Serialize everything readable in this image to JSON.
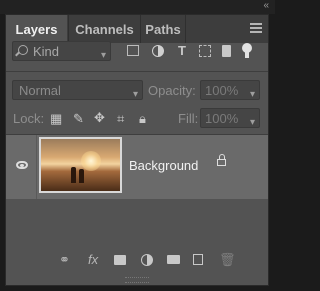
{
  "tabs": [
    {
      "label": "Layers",
      "active": true
    },
    {
      "label": "Channels",
      "active": false
    },
    {
      "label": "Paths",
      "active": false
    }
  ],
  "filter": {
    "kind_label": "Kind"
  },
  "blend": {
    "mode": "Normal",
    "opacity_label": "Opacity:",
    "opacity_value": "100%"
  },
  "lock": {
    "label": "Lock:",
    "fill_label": "Fill:",
    "fill_value": "100%"
  },
  "layers": [
    {
      "name": "Background",
      "visible": true,
      "locked": true
    }
  ],
  "icons": {
    "collapse": "«",
    "fx": "fx"
  },
  "colors": {
    "panel_bg": "#535353",
    "tab_bar_bg": "#3d3d3d",
    "selected_row": "#6a6a6a",
    "outer_bg": "#1b1b1b"
  }
}
